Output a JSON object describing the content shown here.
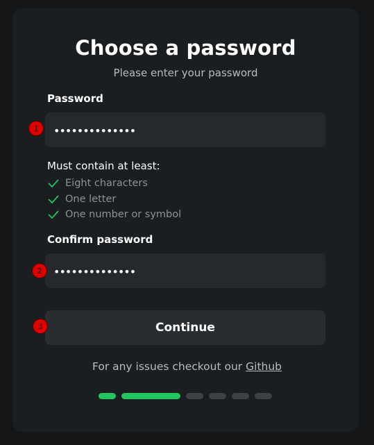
{
  "header": {
    "title": "Choose a password",
    "subtitle": "Please enter your password"
  },
  "password": {
    "label": "Password",
    "value": "••••••••••••••",
    "marker": "1"
  },
  "requirements": {
    "title": "Must contain at least:",
    "items": [
      "Eight characters",
      "One letter",
      "One number or symbol"
    ]
  },
  "confirm": {
    "label": "Confirm password",
    "value": "••••••••••••••",
    "marker": "2"
  },
  "continue_button": {
    "label": "Continue",
    "marker": "3"
  },
  "footer": {
    "text": "For any issues checkout our",
    "link": "Github"
  },
  "progress": {
    "steps": 6,
    "completed": 2
  },
  "colors": {
    "accent": "#22c55e",
    "marker": "#e00000",
    "inactive_step": "#3d4144"
  },
  "icons": {
    "requirement": "check-icon"
  }
}
